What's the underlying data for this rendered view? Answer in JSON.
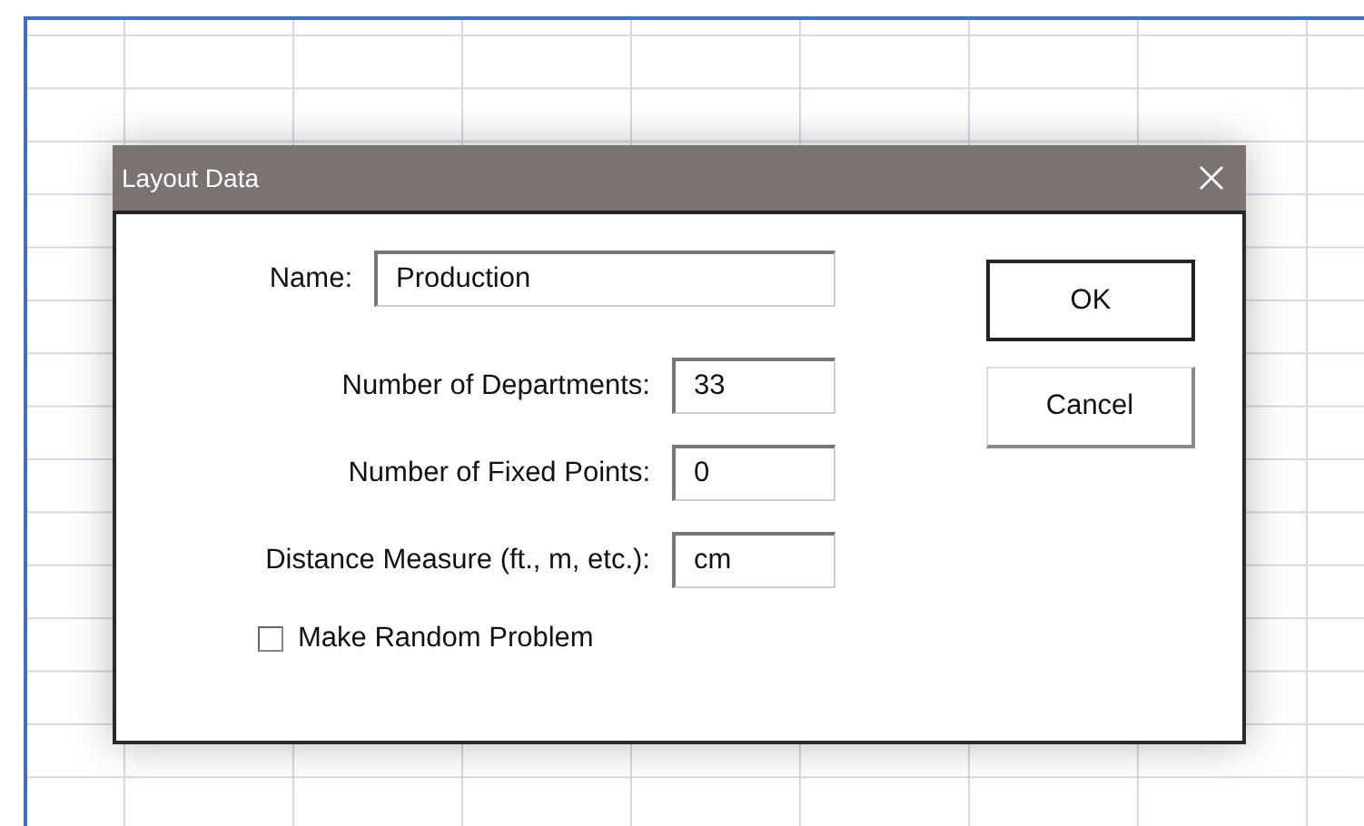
{
  "window": {
    "title": "Layout Data"
  },
  "fields": [
    {
      "kind": "wide",
      "label": "Name:",
      "value": "Production"
    },
    {
      "kind": "short",
      "label": "Number of Departments:",
      "value": "33"
    },
    {
      "kind": "short",
      "label": "Number of Fixed Points:",
      "value": "0"
    },
    {
      "kind": "short",
      "label": "Distance Measure (ft., m, etc.):",
      "value": "cm"
    }
  ],
  "checkbox": {
    "label": "Make Random Problem",
    "checked": false
  },
  "buttons": [
    {
      "label": "OK",
      "default": true
    },
    {
      "label": "Cancel",
      "default": false
    }
  ]
}
